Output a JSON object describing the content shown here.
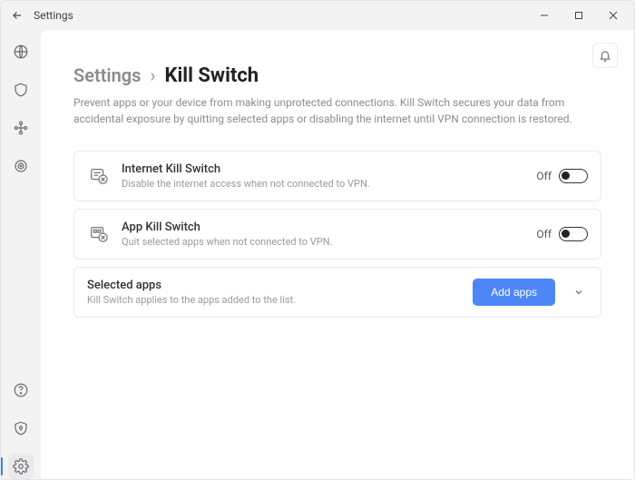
{
  "window": {
    "title": "Settings"
  },
  "breadcrumb": {
    "parent": "Settings",
    "sep": "›",
    "current": "Kill Switch"
  },
  "description": "Prevent apps or your device from making unprotected connections. Kill Switch secures your data from accidental exposure by quitting selected apps or disabling the internet until VPN connection is restored.",
  "settings": {
    "internet_kill": {
      "title": "Internet Kill Switch",
      "desc": "Disable the internet access when not connected to VPN.",
      "state_label": "Off"
    },
    "app_kill": {
      "title": "App Kill Switch",
      "desc": "Quit selected apps when not connected to VPN.",
      "state_label": "Off"
    },
    "selected_apps": {
      "title": "Selected apps",
      "desc": "Kill Switch applies to the apps added to the list.",
      "button": "Add apps"
    }
  }
}
